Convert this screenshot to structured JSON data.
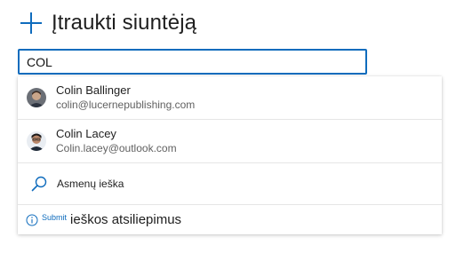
{
  "header": {
    "icon": "plus-icon",
    "title": "Įtraukti siuntėją"
  },
  "search": {
    "value": "COL"
  },
  "suggestions": [
    {
      "name": "Colin Ballinger",
      "email": "colin@lucernepublishing.com",
      "avatar": "avatar-photo"
    },
    {
      "name": "Colin Lacey",
      "email": "Colin.lacey@outlook.com",
      "avatar": "avatar-photo"
    }
  ],
  "people_search": {
    "icon": "search-icon",
    "label": "Asmenų ieška"
  },
  "feedback": {
    "icon": "info-icon",
    "link_label": "Submit",
    "text": "ieškos atsiliepimus"
  },
  "colors": {
    "accent": "#0f6cbd"
  }
}
